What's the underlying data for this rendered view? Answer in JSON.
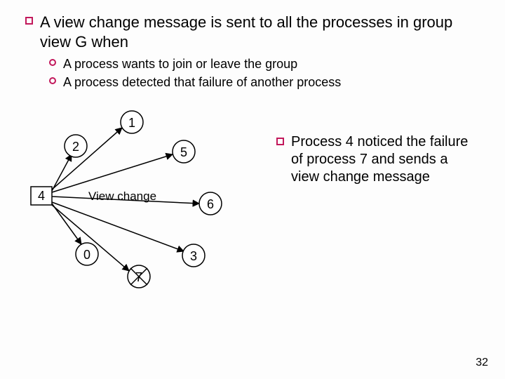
{
  "bullet_main": "A view change message is sent to all the processes in group view G when",
  "sub_bullets": [
    "A process wants to join or leave the group",
    "A process detected that failure of another process"
  ],
  "diagram": {
    "label_view_change": "View change",
    "nodes": {
      "n1": "1",
      "n2": "2",
      "n3": "3",
      "n4": "4",
      "n5": "5",
      "n6": "6",
      "n0": "0",
      "n7": "7"
    }
  },
  "caption": "Process 4 noticed the failure of process 7 and sends a view change message",
  "page_number": "32"
}
